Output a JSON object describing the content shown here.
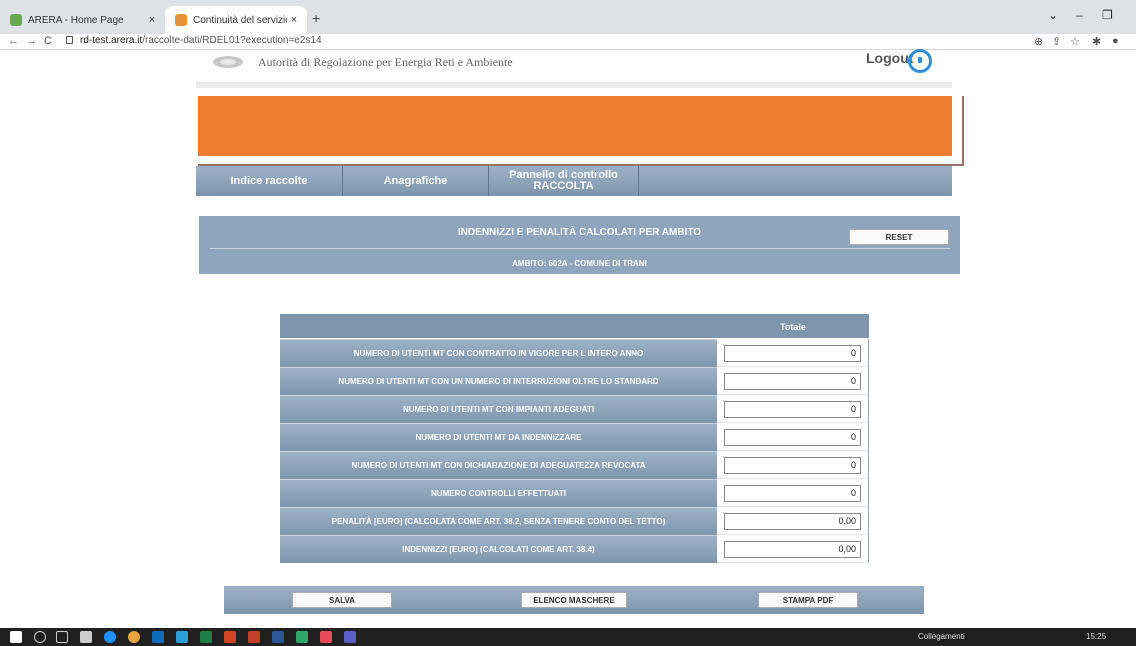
{
  "browser": {
    "tabs": [
      {
        "title": "ARERA - Home Page",
        "close": "×"
      },
      {
        "title": "Continuità del servizio elettrico",
        "close": "×"
      }
    ],
    "new_tab": "+",
    "window_controls": {
      "minimize": "–",
      "maximize": "❐",
      "more": "⌄"
    },
    "url_host": "rd-test.arera.it",
    "url_path": "/raccolte-dati/RDEL01?execution=e2s14",
    "nav": {
      "back": "←",
      "forward": "→",
      "reload": "C"
    }
  },
  "header": {
    "authority": "Autorità di Regolazione per Energia Reti e Ambiente",
    "logout": "Logout"
  },
  "menu": {
    "items": [
      "Indice raccolte",
      "Anagrafiche",
      "Pannello di controllo RACCOLTA"
    ]
  },
  "panel": {
    "title": "INDENNIZZI E PENALITÀ CALCOLATI PER AMBITO",
    "subtitle": "AMBITO: 602A - COMUNE DI TRANI",
    "reset": "RESET"
  },
  "table": {
    "header": "Totale",
    "rows": [
      {
        "label": "NUMERO DI UTENTI MT CON CONTRATTO IN VIGORE PER L INTERO ANNO",
        "value": "0"
      },
      {
        "label": "NUMERO DI UTENTI MT CON UN NUMERO DI INTERRUZIONI OLTRE LO STANDARD",
        "value": "0"
      },
      {
        "label": "NUMERO DI UTENTI MT CON IMPIANTI ADEGUATI",
        "value": "0"
      },
      {
        "label": "NUMERO DI UTENTI MT DA INDENNIZZARE",
        "value": "0"
      },
      {
        "label": "NUMERO DI UTENTI MT CON DICHIARAZIONE DI ADEGUATEZZA REVOCATA",
        "value": "0"
      },
      {
        "label": "NUMERO CONTROLLI EFFETTUATI",
        "value": "0"
      },
      {
        "label": "PENALITÀ [EURO] (CALCOLATA COME ART. 38.2, SENZA TENERE CONTO DEL TETTO)",
        "value": "0,00"
      },
      {
        "label": "INDENNIZZI [EURO] (CALCOLATI COME ART. 38.4)",
        "value": "0,00"
      }
    ]
  },
  "footer": {
    "save": "SALVA",
    "list": "ELENCO MASCHERE",
    "print": "STAMPA PDF"
  },
  "taskbar": {
    "network": "Collegamenti",
    "time": "15:25"
  },
  "colors": {
    "accent_orange": "#ef7d31",
    "panel_blue": "#8ea5bd",
    "menu_blue": "#7d95ad"
  }
}
